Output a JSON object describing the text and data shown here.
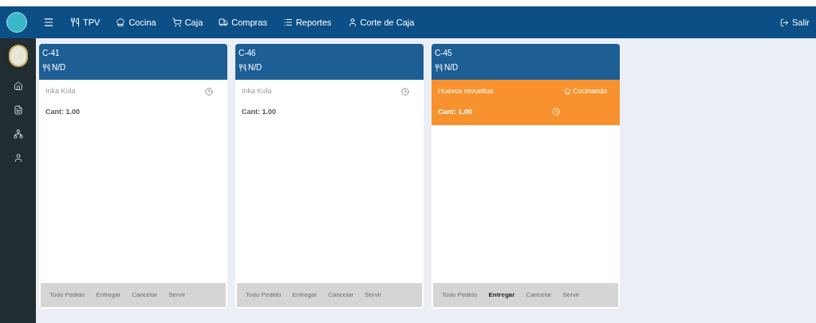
{
  "navbar": {
    "items": [
      {
        "kind": "menu"
      },
      {
        "kind": "link",
        "label": "TPV"
      },
      {
        "kind": "link",
        "label": "Cocina"
      },
      {
        "kind": "link",
        "label": "Caja"
      },
      {
        "kind": "link",
        "label": "Compras"
      },
      {
        "kind": "link",
        "label": "Reportes"
      },
      {
        "kind": "link",
        "label": "Corte de Caja"
      }
    ],
    "logout": "Salir"
  },
  "orders": [
    {
      "code": "C-41",
      "table": "N/D",
      "items": [
        {
          "name": "Inka Kola",
          "qty": "Cant: 1.00",
          "highlighted": false
        }
      ],
      "actions": [
        {
          "label": "Todo Pedido",
          "disabled": true
        },
        {
          "label": "Entregar",
          "disabled": true
        },
        {
          "label": "Cancelar",
          "disabled": true
        },
        {
          "label": "Servir",
          "disabled": true
        }
      ]
    },
    {
      "code": "C-46",
      "table": "N/D",
      "items": [
        {
          "name": "Inka Kola",
          "qty": "Cant: 1.00",
          "highlighted": false
        }
      ],
      "actions": [
        {
          "label": "Todo Pedido",
          "disabled": true
        },
        {
          "label": "Entregar",
          "disabled": true
        },
        {
          "label": "Cancelar",
          "disabled": true
        },
        {
          "label": "Servir",
          "disabled": true
        }
      ]
    },
    {
      "code": "C-45",
      "table": "N/D",
      "items": [
        {
          "name": "Huevos revueltos",
          "status": "Cocinando",
          "qty": "Cant: 1.00",
          "highlighted": true
        }
      ],
      "actions": [
        {
          "label": "Todo Pedido",
          "disabled": true
        },
        {
          "label": "Entregar",
          "disabled": false
        },
        {
          "label": "Cancelar",
          "disabled": true
        },
        {
          "label": "Servir",
          "disabled": true
        }
      ]
    }
  ]
}
